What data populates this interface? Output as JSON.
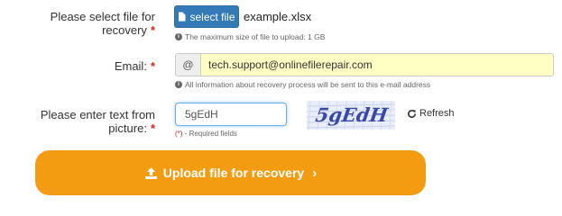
{
  "file_row": {
    "label": "Please select file for recovery",
    "required_mark": "*",
    "select_button_label": "select file",
    "selected_file": "example.xlsx",
    "hint": "The maximum size of file to upload: 1 GB"
  },
  "email_row": {
    "label": "Email:",
    "required_mark": "*",
    "addon": "@",
    "value": "tech.support@onlinefilerepair.com",
    "hint": "All information about recovery process will be sent to this e-mail address"
  },
  "captcha_row": {
    "label": "Please enter text from picture:",
    "required_mark": "*",
    "value": "5gEdH",
    "captcha_text": "5gEdH",
    "refresh_label": "Refresh",
    "required_note_mark": "(*)",
    "required_note_text": " - Required fields"
  },
  "upload_button": {
    "label": "Upload file for recovery",
    "arrow": "›"
  },
  "colors": {
    "primary_button": "#337ab7",
    "upload_button": "#f39c12",
    "email_highlight": "#ffffc4",
    "required": "#d9261c"
  },
  "icons": {
    "file": "file-icon",
    "info": "info-circle-icon",
    "refresh": "refresh-icon",
    "upload": "upload-icon",
    "chevron": "chevron-right-icon"
  }
}
